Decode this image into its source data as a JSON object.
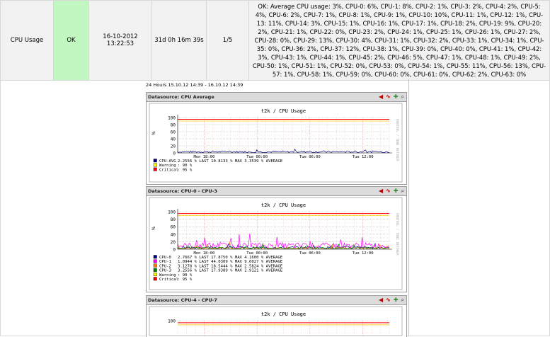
{
  "service": {
    "name": "CPU Usage",
    "status": "OK",
    "last_check": "16-10-2012 13:22:53",
    "duration": "31d 0h 16m 39s",
    "attempt": "1/5",
    "info": "OK: Average CPU usage: 3%, CPU-0: 6%, CPU-1: 8%, CPU-2: 1%, CPU-3: 2%, CPU-4: 2%, CPU-5: 4%, CPU-6: 2%, CPU-7: 1%, CPU-8: 1%, CPU-9: 1%, CPU-10: 10%, CPU-11: 1%, CPU-12: 1%, CPU-13: 11%, CPU-14: 3%, CPU-15: 1%, CPU-16: 1%, CPU-17: 1%, CPU-18: 2%, CPU-19: 9%, CPU-20: 2%, CPU-21: 1%, CPU-22: 0%, CPU-23: 2%, CPU-24: 1%, CPU-25: 1%, CPU-26: 1%, CPU-27: 2%, CPU-28: 0%, CPU-29: 13%, CPU-30: 4%, CPU-31: 1%, CPU-32: 2%, CPU-33: 1%, CPU-34: 1%, CPU-35: 0%, CPU-36: 2%, CPU-37: 12%, CPU-38: 1%, CPU-39: 0%, CPU-40: 0%, CPU-41: 1%, CPU-42: 3%, CPU-43: 1%, CPU-44: 1%, CPU-45: 2%, CPU-46: 5%, CPU-47: 1%, CPU-48: 1%, CPU-49: 2%, CPU-50: 1%, CPU-51: 1%, CPU-52: 0%, CPU-53: 0%, CPU-54: 1%, CPU-55: 11%, CPU-56: 13%, CPU-57: 1%, CPU-58: 1%, CPU-59: 0%, CPU-60: 0%, CPU-61: 0%, CPU-62: 2%, CPU-63: 0%"
  },
  "graphs": {
    "period": "24 Hours 15.10.12 14:39 - 16.10.12 14:39",
    "colors": {
      "warning_line": "#ff0000",
      "grid": "#e8a0a0",
      "cpu_avg": "#000080"
    },
    "panels": [
      {
        "header": "Datasource: CPU Average",
        "title": "t2k        / CPU Usage",
        "y_unit": "%",
        "side_label": "RRDTOOL / TOBI OETIKER",
        "y_ticks": [
          "100",
          "80",
          "60",
          "40",
          "20",
          "0"
        ],
        "x_ticks": [
          "Mon 18:00",
          "Tue 00:00",
          "Tue 06:00",
          "Tue 12:00"
        ],
        "legend": [
          {
            "color": "#000080",
            "label": "CPU-AVG",
            "text": "2.2556 % LAST    10.8133 % MAX    3.3539 % AVERAGE"
          },
          {
            "color": "#ffff00",
            "label": "Warning",
            "text": ": 90 %"
          },
          {
            "color": "#ff0000",
            "label": "Critical",
            "text": ": 95 %"
          }
        ]
      },
      {
        "header": "Datasource: CPU-0 - CPU-3",
        "title": "t2k        / CPU Usage",
        "y_unit": "%",
        "side_label": "RRDTOOL / TOBI OETIKER",
        "y_ticks": [
          "100",
          "80",
          "60",
          "40",
          "20",
          "0"
        ],
        "x_ticks": [
          "Mon 18:00",
          "Tue 00:00",
          "Tue 06:00",
          "Tue 12:00"
        ],
        "legend": [
          {
            "color": "#000080",
            "label": "CPU-0",
            "text": "2.7667 % LAST    17.8750 % MAX    4.1600 % AVERAGE"
          },
          {
            "color": "#ff00ff",
            "label": "CPU-1",
            "text": "1.0944 % LAST    44.0309 % MAX    9.6027 % AVERAGE"
          },
          {
            "color": "#ff8000",
            "label": "CPU-2",
            "text": "3.1278 % LAST    18.5444 % MAX    2.5824 % AVERAGE"
          },
          {
            "color": "#008000",
            "label": "CPU-3",
            "text": "3.2556 % LAST    17.9389 % MAX    2.9121 % AVERAGE"
          },
          {
            "color": "#ffff00",
            "label": "Warning",
            "text": ": 90 %"
          },
          {
            "color": "#ff0000",
            "label": "Critical",
            "text": ": 95 %"
          }
        ]
      },
      {
        "header": "Datasource: CPU-4 - CPU-7",
        "title": "t2k        / CPU Usage",
        "y_ticks": [
          "100"
        ]
      }
    ]
  }
}
